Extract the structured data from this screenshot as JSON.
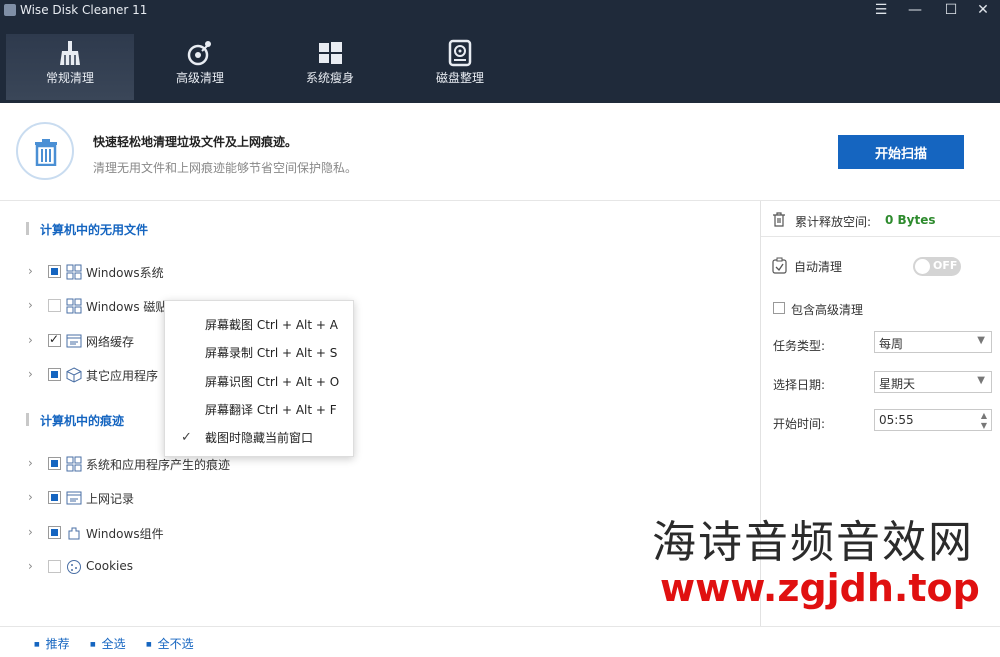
{
  "app": {
    "title": "Wise Disk Cleaner 11"
  },
  "window": {
    "menu": "☰",
    "minimize": "—",
    "maximize": "☐",
    "close": "✕"
  },
  "nav": {
    "tabs": [
      {
        "label": "常规清理",
        "icon": "broom-icon",
        "active": true
      },
      {
        "label": "高级清理",
        "icon": "advanced-clean-icon",
        "active": false
      },
      {
        "label": "系统瘦身",
        "icon": "windows-icon",
        "active": false
      },
      {
        "label": "磁盘整理",
        "icon": "disk-icon",
        "active": false
      }
    ]
  },
  "banner": {
    "title": "快速轻松地清理垃圾文件及上网痕迹。",
    "subtitle": "清理无用文件和上网痕迹能够节省空间保护隐私。",
    "scan_button": "开始扫描"
  },
  "sections": {
    "junk": {
      "title": "计算机中的无用文件",
      "items": [
        {
          "label": "Windows系统",
          "state": "partial",
          "icon": "windows-grid-icon"
        },
        {
          "label": "Windows 磁贴缓存",
          "state": "empty",
          "icon": "windows-grid-icon"
        },
        {
          "label": "网络缓存",
          "state": "checked",
          "icon": "browser-icon"
        },
        {
          "label": "其它应用程序",
          "state": "partial",
          "icon": "cube-icon"
        }
      ]
    },
    "traces": {
      "title": "计算机中的痕迹",
      "items": [
        {
          "label": "系统和应用程序产生的痕迹",
          "state": "partial",
          "icon": "windows-grid-icon"
        },
        {
          "label": "上网记录",
          "state": "partial",
          "icon": "browser-icon"
        },
        {
          "label": "Windows组件",
          "state": "partial",
          "icon": "component-icon"
        },
        {
          "label": "Cookies",
          "state": "empty",
          "icon": "cookie-icon"
        }
      ]
    }
  },
  "right": {
    "freed_label": "累计释放空间:",
    "freed_value": "0 Bytes",
    "auto_clean_label": "自动清理",
    "toggle_text": "OFF",
    "include_advanced": "包含高级清理",
    "task_type_label": "任务类型:",
    "task_type_value": "每周",
    "date_label": "选择日期:",
    "date_value": "星期天",
    "time_label": "开始时间:",
    "time_value": "05:55"
  },
  "footer": {
    "recommend": "推荐",
    "select_all": "全选",
    "select_none": "全不选"
  },
  "context_menu": {
    "items": [
      "屏幕截图 Ctrl + Alt + A",
      "屏幕录制 Ctrl + Alt + S",
      "屏幕识图 Ctrl + Alt + O",
      "屏幕翻译 Ctrl + Alt + F",
      "截图时隐藏当前窗口"
    ]
  },
  "watermark": {
    "cn": "海诗音频音效网",
    "url": "www.zgjdh.top"
  },
  "colors": {
    "header": "#1f2a3a",
    "accent": "#1565c0",
    "green": "#2e8b2e",
    "watermark_red": "#e01010"
  }
}
